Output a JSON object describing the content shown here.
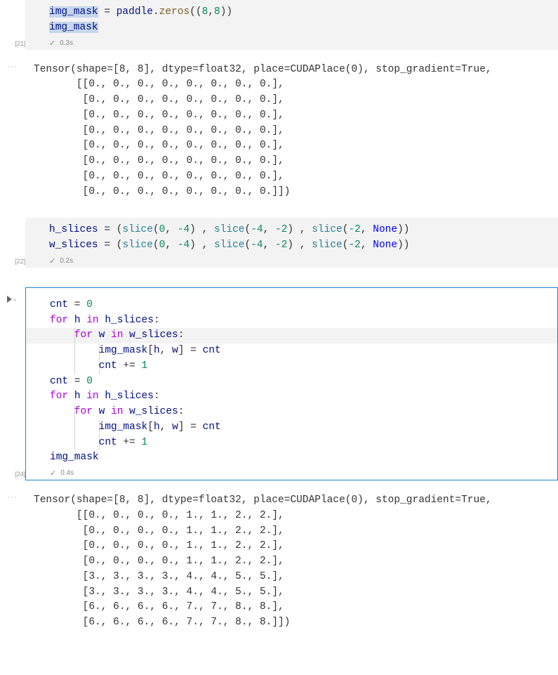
{
  "cells": [
    {
      "exec_count": "[21]",
      "time": "0.3s",
      "output_header": "Tensor(shape=[8, 8], dtype=float32, place=CUDAPlace(0), stop_gradient=True,",
      "out_r0": "       [[0., 0., 0., 0., 0., 0., 0., 0.],",
      "out_r1": "        [0., 0., 0., 0., 0., 0., 0., 0.],",
      "out_r2": "        [0., 0., 0., 0., 0., 0., 0., 0.],",
      "out_r3": "        [0., 0., 0., 0., 0., 0., 0., 0.],",
      "out_r4": "        [0., 0., 0., 0., 0., 0., 0., 0.],",
      "out_r5": "        [0., 0., 0., 0., 0., 0., 0., 0.],",
      "out_r6": "        [0., 0., 0., 0., 0., 0., 0., 0.],",
      "out_r7": "        [0., 0., 0., 0., 0., 0., 0., 0.]])"
    },
    {
      "exec_count": "[22]",
      "time": "0.2s"
    },
    {
      "exec_count": "[24]",
      "time": "0.4s",
      "output_header": "Tensor(shape=[8, 8], dtype=float32, place=CUDAPlace(0), stop_gradient=True,",
      "out_r0": "       [[0., 0., 0., 0., 1., 1., 2., 2.],",
      "out_r1": "        [0., 0., 0., 0., 1., 1., 2., 2.],",
      "out_r2": "        [0., 0., 0., 0., 1., 1., 2., 2.],",
      "out_r3": "        [0., 0., 0., 0., 1., 1., 2., 2.],",
      "out_r4": "        [3., 3., 3., 3., 4., 4., 5., 5.],",
      "out_r5": "        [3., 3., 3., 3., 4., 4., 5., 5.],",
      "out_r6": "        [6., 6., 6., 6., 7., 7., 8., 8.],",
      "out_r7": "        [6., 6., 6., 6., 7., 7., 8., 8.]])"
    }
  ],
  "code1": {
    "line1_p1": "img_mask",
    "line1_p2": " = ",
    "line1_p3": "paddle",
    "line1_p4": ".",
    "line1_p5": "zeros",
    "line1_p6": "((",
    "line1_p7": "8",
    "line1_p8": ",",
    "line1_p9": "8",
    "line1_p10": "))",
    "line2": "img_mask"
  },
  "code2": {
    "hs": "h_slices",
    "ws": "w_slices",
    "eq": " = (",
    "slice": "slice",
    "op": "(",
    "z": "0",
    "c": ", ",
    "m4": "-4",
    "m2": "-2",
    "cp": ") , ",
    "none": "None",
    "end": "))"
  },
  "code3": {
    "cnt": "cnt",
    "eq0": " = ",
    "z": "0",
    "for": "for",
    "h": "h",
    "w": "w",
    "in": "in",
    "hs": "h_slices",
    "ws": "w_slices",
    "colon": ":",
    "img": "img_mask",
    "br": "[",
    "brc": "]",
    "eq": " = ",
    "plus": " += ",
    "one": "1",
    "comma": ", "
  }
}
